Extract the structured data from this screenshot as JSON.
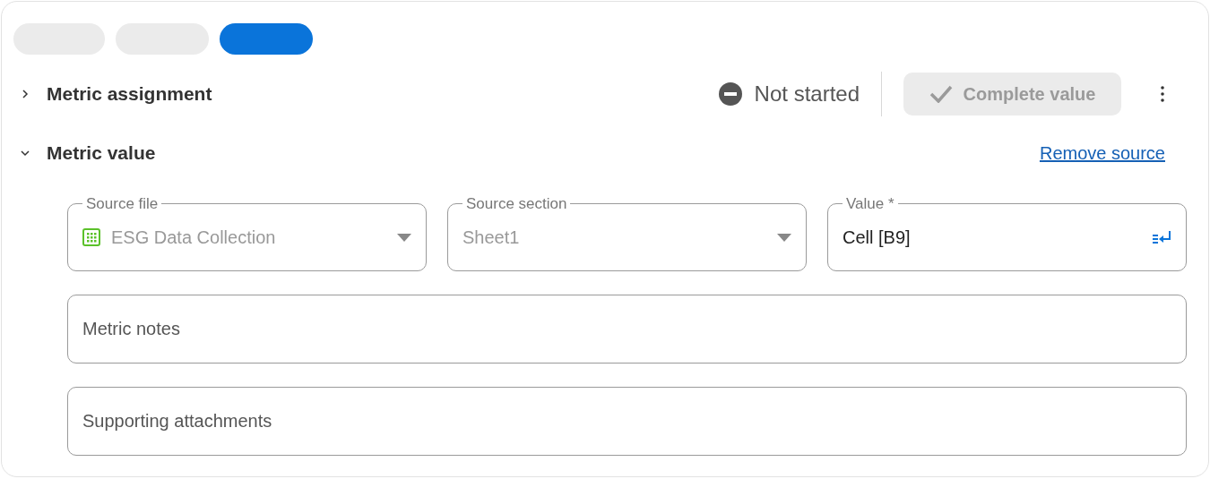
{
  "pills": [
    {
      "selected": false
    },
    {
      "selected": false
    },
    {
      "selected": true
    }
  ],
  "sections": [
    {
      "title": "Metric assignment",
      "expanded": false
    },
    {
      "title": "Metric value",
      "expanded": true
    }
  ],
  "status": {
    "label": "Not started"
  },
  "complete_button": {
    "label": "Complete value",
    "disabled": true
  },
  "remove_source_link": "Remove source",
  "source_fields": [
    {
      "kind": "dropdown",
      "label": "Source file",
      "value": "ESG Data Collection",
      "file_icon": true,
      "disabled": true
    },
    {
      "kind": "dropdown",
      "label": "Source section",
      "value": "Sheet1",
      "file_icon": false,
      "disabled": true
    },
    {
      "kind": "input",
      "label": "Value *",
      "value": "Cell [B9]",
      "disabled": false
    }
  ],
  "text_fields": [
    {
      "placeholder": "Metric notes"
    },
    {
      "placeholder": "Supporting attachments"
    }
  ]
}
